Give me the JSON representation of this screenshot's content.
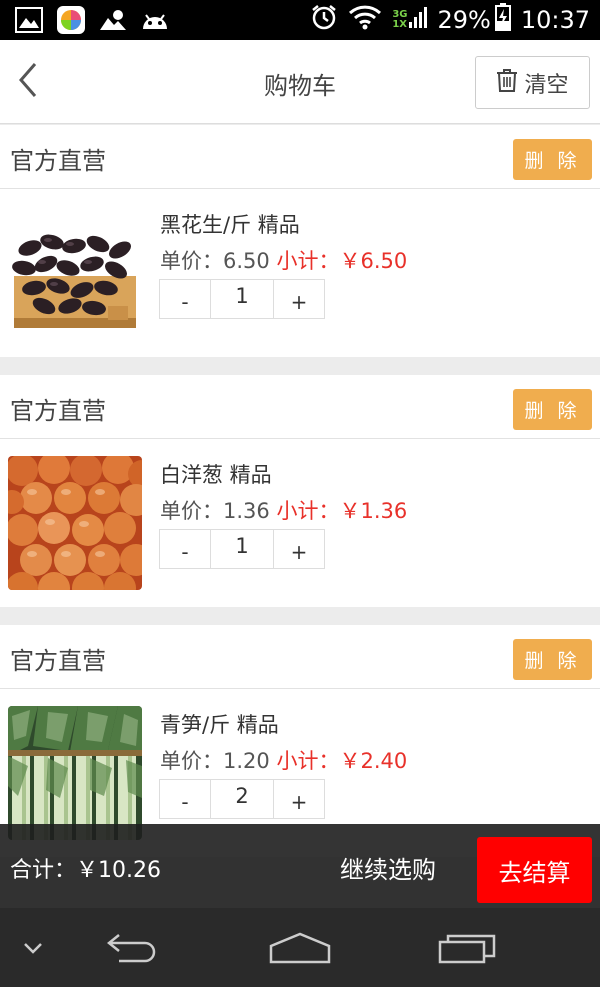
{
  "status_bar": {
    "network_type_top": "3G",
    "network_type_bottom": "1X",
    "battery": "29%",
    "time": "10:37"
  },
  "header": {
    "title": "购物车",
    "clear_label": "清空"
  },
  "groups": [
    {
      "shop": "官方直营",
      "delete_label": "删 除",
      "name": "黑花生/斤 精品",
      "unit_price": "单价：6.50",
      "subtotal": "小计：￥6.50",
      "minus": "-",
      "qty": "1",
      "plus": "+"
    },
    {
      "shop": "官方直营",
      "delete_label": "删 除",
      "name": "白洋葱 精品",
      "unit_price": "单价：1.36",
      "subtotal": "小计：￥1.36",
      "minus": "-",
      "qty": "1",
      "plus": "+"
    },
    {
      "shop": "官方直营",
      "delete_label": "删 除",
      "name": "青笋/斤 精品",
      "unit_price": "单价：1.20",
      "subtotal": "小计：￥2.40",
      "minus": "-",
      "qty": "2",
      "plus": "+"
    }
  ],
  "footer": {
    "total": "合计：￥10.26",
    "continue_label": "继续选购",
    "checkout_label": "去结算"
  },
  "colors": {
    "delete_button": "#f0ad4e",
    "checkout_button": "#ff0000",
    "subtotal_text": "#e8312a"
  },
  "icons": [
    "gallery-icon",
    "app-icon",
    "weather-icon",
    "android-icon",
    "alarm-icon",
    "wifi-icon",
    "signal-icon",
    "battery-charging-icon",
    "back-arrow-icon",
    "trash-icon",
    "nav-collapse-icon",
    "nav-back-icon",
    "nav-home-icon",
    "nav-recents-icon"
  ]
}
